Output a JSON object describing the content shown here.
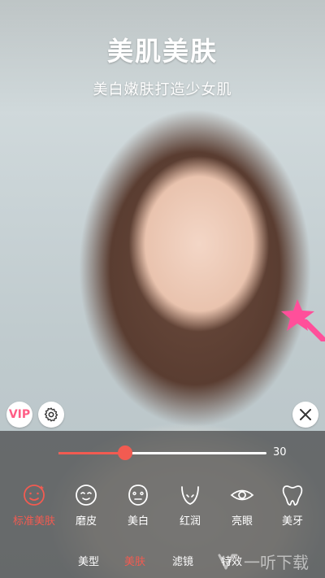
{
  "header": {
    "title": "美肌美肤",
    "subtitle": "美白嫩肤打造少女肌"
  },
  "controls": {
    "vip_label": "VIP",
    "settings_icon": "gear-icon",
    "close_icon": "close-icon"
  },
  "slider": {
    "value": 30,
    "value_text": "30",
    "fill_fraction": 0.32
  },
  "tools": [
    {
      "label": "标准美肤",
      "icon": "smart-face-icon",
      "active": true
    },
    {
      "label": "磨皮",
      "icon": "smooth-face-icon",
      "active": false
    },
    {
      "label": "美白",
      "icon": "whitening-mask-icon",
      "active": false
    },
    {
      "label": "红润",
      "icon": "rosy-chin-icon",
      "active": false
    },
    {
      "label": "亮眼",
      "icon": "eye-icon",
      "active": false
    },
    {
      "label": "美牙",
      "icon": "tooth-icon",
      "active": false
    }
  ],
  "nav": [
    {
      "label": "美型",
      "active": false
    },
    {
      "label": "美肤",
      "active": true
    },
    {
      "label": "滤镜",
      "active": false
    },
    {
      "label": "特效",
      "active": false
    }
  ],
  "watermark": {
    "text": "一听下载"
  },
  "colors": {
    "accent": "#f25b51",
    "vip": "#ff5e86",
    "panel": "#464646"
  }
}
